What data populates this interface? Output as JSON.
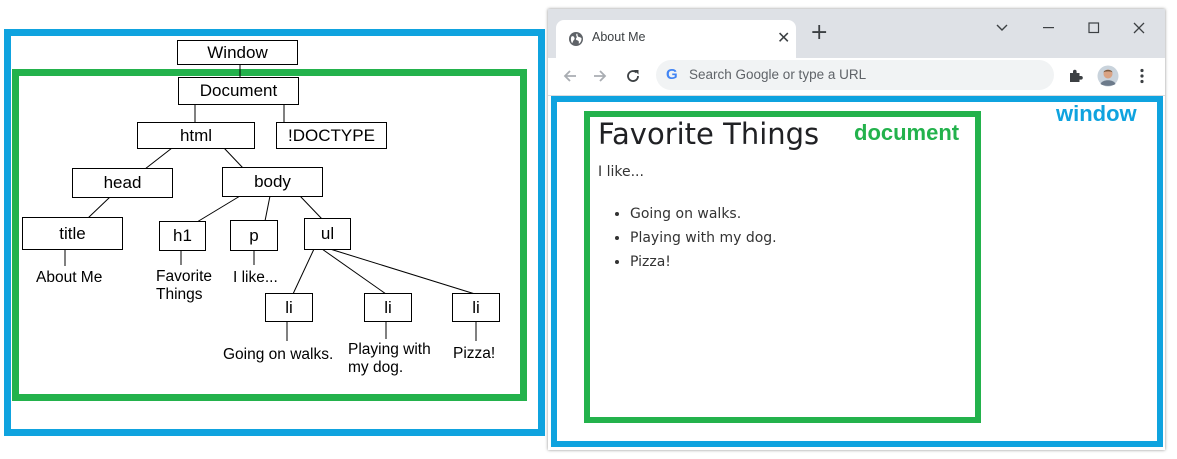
{
  "diagram": {
    "nodes": {
      "window": "Window",
      "document": "Document",
      "html": "html",
      "doctype": "!DOCTYPE",
      "head": "head",
      "body": "body",
      "title": "title",
      "h1": "h1",
      "p": "p",
      "ul": "ul",
      "li1": "li",
      "li2": "li",
      "li3": "li"
    },
    "leaves": {
      "title_text": "About Me",
      "h1_text_line1": "Favorite",
      "h1_text_line2": "Things",
      "p_text": "I like...",
      "li1_text": "Going on walks.",
      "li2_text_line1": "Playing with",
      "li2_text_line2": "my dog.",
      "li3_text": "Pizza!"
    },
    "colors": {
      "window_frame": "#0fa3df",
      "document_frame": "#23b24c"
    }
  },
  "browser": {
    "tab": {
      "title": "About Me",
      "close": "✕",
      "icon": "globe-icon"
    },
    "new_tab": "+",
    "omnibox": {
      "placeholder": "Search Google or type a URL",
      "logo": "G"
    },
    "labels": {
      "window": "window",
      "document": "document"
    },
    "page": {
      "heading": "Favorite Things",
      "intro": "I like...",
      "items": [
        "Going on walks.",
        "Playing with my dog.",
        "Pizza!"
      ]
    }
  }
}
